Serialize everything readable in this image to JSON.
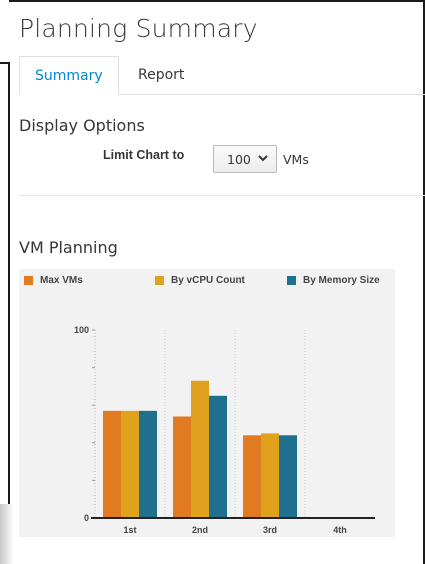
{
  "page": {
    "title": "Planning Summary"
  },
  "tabs": [
    {
      "label": "Summary",
      "active": true
    },
    {
      "label": "Report",
      "active": false
    }
  ],
  "display_options": {
    "heading": "Display Options",
    "limit_label": "Limit Chart to",
    "limit_value": "100",
    "limit_unit": "VMs"
  },
  "vm_planning": {
    "heading": "VM Planning"
  },
  "colors": {
    "max_vms": "#e07b22",
    "by_vcpu": "#e0a21c",
    "by_memory": "#1f6f8f",
    "tab_active": "#0088ce"
  },
  "chart_data": {
    "type": "bar",
    "categories": [
      "1st",
      "2nd",
      "3rd",
      "4th"
    ],
    "series": [
      {
        "name": "Max VMs",
        "color": "#e07b22",
        "values": [
          57,
          54,
          44,
          0
        ]
      },
      {
        "name": "By vCPU Count",
        "color": "#e0a21c",
        "values": [
          57,
          73,
          45,
          0
        ]
      },
      {
        "name": "By Memory Size",
        "color": "#1f6f8f",
        "values": [
          57,
          65,
          44,
          0
        ]
      }
    ],
    "ylim": [
      0,
      100
    ],
    "yticks": [
      "0",
      "100"
    ],
    "legend_position": "top",
    "grid": "vertical dotted"
  }
}
